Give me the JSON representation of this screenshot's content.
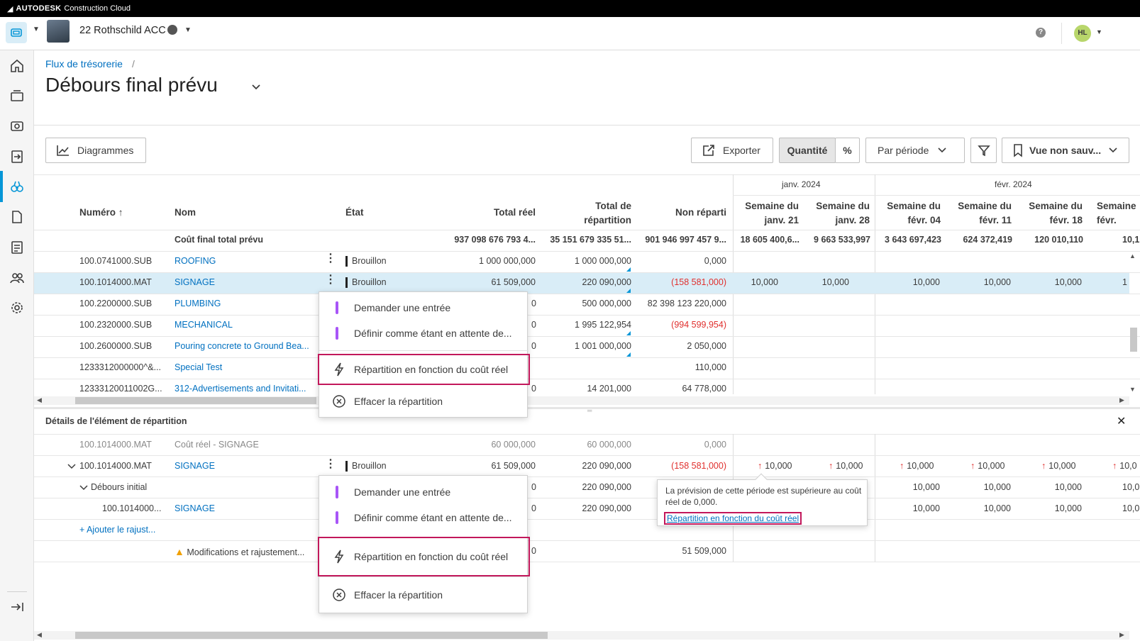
{
  "brand": {
    "name": "AUTODESK",
    "product": "Construction Cloud"
  },
  "header": {
    "project": "22 Rothschild ACC",
    "user_initials": "HL"
  },
  "breadcrumb": {
    "parent": "Flux de trésorerie",
    "separator": "/"
  },
  "page_title": "Débours final prévu",
  "toolbar": {
    "charts": "Diagrammes",
    "export": "Exporter",
    "quantity": "Quantité",
    "percent": "%",
    "period": "Par période",
    "view": "Vue non sauv..."
  },
  "months": {
    "jan": "janv. 2024",
    "feb": "févr. 2024"
  },
  "columns": {
    "numero": "Numéro",
    "nom": "Nom",
    "etat": "État",
    "total_reel": "Total réel",
    "total_rep_1": "Total de",
    "total_rep_2": "répartition",
    "non_reparti": "Non réparti",
    "w1a": "Semaine du",
    "w1b": "janv. 21",
    "w2a": "Semaine du",
    "w2b": "janv. 28",
    "w3a": "Semaine du",
    "w3b": "févr. 04",
    "w4a": "Semaine du",
    "w4b": "févr. 11",
    "w5a": "Semaine du",
    "w5b": "févr. 18",
    "w6a": "Semaine",
    "w6b": "févr."
  },
  "summary": {
    "label": "Coût final total prévu",
    "total_reel": "937 098 676 793 4...",
    "total_rep": "35 151 679 335 51...",
    "non_reparti": "901 946 997 457 9...",
    "w1": "18 605 400,6...",
    "w2": "9 663 533,997",
    "w3": "3 643 697,423",
    "w4": "624 372,419",
    "w5": "120 010,110",
    "w6": "10,1"
  },
  "rows": [
    {
      "num": "100.0741000.SUB",
      "name": "ROOFING",
      "state": "Brouillon",
      "reel": "1 000 000,000",
      "rep": "1 000 000,000",
      "non": "0,000"
    },
    {
      "num": "100.1014000.MAT",
      "name": "SIGNAGE",
      "state": "Brouillon",
      "reel": "61 509,000",
      "rep": "220 090,000",
      "non": "(158 581,000)",
      "w": "10,000",
      "w6": "1"
    },
    {
      "num": "100.2200000.SUB",
      "name": "PLUMBING",
      "reel": "0",
      "rep": "500 000,000",
      "non": "82 398 123 220,000"
    },
    {
      "num": "100.2320000.SUB",
      "name": "MECHANICAL",
      "reel": "0",
      "rep": "1 995 122,954",
      "non": "(994 599,954)"
    },
    {
      "num": "100.2600000.SUB",
      "name": "Pouring concrete to Ground Bea...",
      "reel": "0",
      "rep": "1 001 000,000",
      "non": "2 050,000"
    },
    {
      "num": "1233312000000^&...",
      "name": "Special Test",
      "reel": "",
      "rep": "",
      "non": "110,000"
    },
    {
      "num": "12333120011002G...",
      "name": "312-Advertisements and Invitati...",
      "reel": "0",
      "rep": "14 201,000",
      "non": "64 778,000"
    }
  ],
  "menu": {
    "request_entry": "Demander une entrée",
    "set_pending": "Définir comme étant en attente de...",
    "distribute_actual": "Répartition en fonction du coût réel",
    "clear_distribution": "Effacer la répartition"
  },
  "details": {
    "title": "Détails de l'élément de répartition",
    "actual_row": {
      "num": "100.1014000.MAT",
      "name": "Coût réel - SIGNAGE",
      "reel": "60 000,000",
      "rep": "60 000,000",
      "non": "0,000"
    },
    "main_row": {
      "num": "100.1014000.MAT",
      "name": "SIGNAGE",
      "state": "Brouillon",
      "reel": "61 509,000",
      "rep": "220 090,000",
      "non": "(158 581,000)",
      "w": "10,000",
      "w6": "10,0"
    },
    "initial": {
      "label": "Débours initial",
      "reel": "0",
      "rep": "220 090,000"
    },
    "sub_row": {
      "num": "100.1014000...",
      "name": "SIGNAGE",
      "reel": "0",
      "rep": "220 090,000",
      "w": "10,000",
      "w6": "10,0"
    },
    "add_adjust": "+ Ajouter le rajust...",
    "changes": {
      "label": "Modifications et rajustement...",
      "reel": "0",
      "non": "51 509,000"
    }
  },
  "tooltip": {
    "text": "La prévision de cette période est supérieure au coût réel de 0,000.",
    "link": "Répartition en fonction du coût réel"
  },
  "colors": {
    "accent": "#0696d7",
    "link": "#0070c0",
    "negative": "#e0302e",
    "highlight": "#c2185b",
    "selected_row": "#d9edf7",
    "status_purple": "#a855f7"
  }
}
